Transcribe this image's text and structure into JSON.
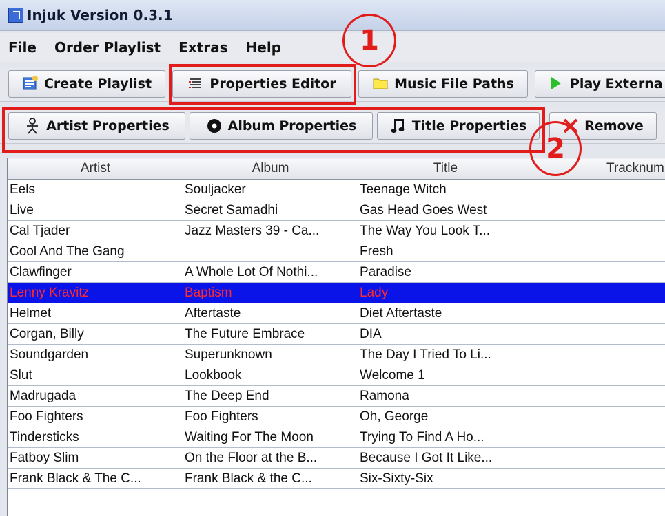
{
  "window": {
    "title": "Injuk Version 0.3.1"
  },
  "menu": [
    "File",
    "Order Playlist",
    "Extras",
    "Help"
  ],
  "toolbar1": [
    {
      "label": "Create Playlist",
      "icon": "playlist-icon"
    },
    {
      "label": "Properties Editor",
      "icon": "list-icon"
    },
    {
      "label": "Music File Paths",
      "icon": "folder-icon"
    },
    {
      "label": "Play Externa",
      "icon": "play-icon"
    }
  ],
  "toolbar2": [
    {
      "label": "Artist Properties",
      "icon": "person-icon"
    },
    {
      "label": "Album Properties",
      "icon": "disc-icon"
    },
    {
      "label": "Title Properties",
      "icon": "music-note-icon"
    },
    {
      "label": "Remove",
      "icon": "remove-icon"
    }
  ],
  "annotations": {
    "one": "1",
    "two": "2"
  },
  "table": {
    "columns": [
      "Artist",
      "Album",
      "Title",
      "Tracknumbe"
    ],
    "rows": [
      [
        "Eels",
        "Souljacker",
        "Teenage Witch",
        ""
      ],
      [
        "Live",
        "Secret Samadhi",
        "Gas Head Goes West",
        ""
      ],
      [
        "Cal Tjader",
        "Jazz Masters 39 - Ca...",
        "The Way You Look T...",
        ""
      ],
      [
        "Cool And The Gang",
        "",
        "Fresh",
        ""
      ],
      [
        "Clawfinger",
        "A Whole Lot Of Nothi...",
        "Paradise",
        ""
      ],
      [
        "Lenny Kravitz",
        "Baptism",
        "Lady",
        ""
      ],
      [
        "Helmet",
        "Aftertaste",
        "Diet Aftertaste",
        ""
      ],
      [
        "Corgan, Billy",
        "The Future Embrace",
        "DIA",
        ""
      ],
      [
        "Soundgarden",
        "Superunknown",
        "The Day I Tried To Li...",
        ""
      ],
      [
        "Slut",
        "Lookbook",
        "Welcome 1",
        ""
      ],
      [
        "Madrugada",
        "The Deep End",
        "Ramona",
        ""
      ],
      [
        "Foo Fighters",
        "Foo Fighters",
        "Oh, George",
        ""
      ],
      [
        "Tindersticks",
        "Waiting For The Moon",
        "Trying To Find A Ho...",
        ""
      ],
      [
        "Fatboy Slim",
        "On the Floor at the B...",
        "Because I Got It Like...",
        ""
      ],
      [
        "Frank Black & The C...",
        "Frank Black & the C...",
        "Six-Sixty-Six",
        ""
      ]
    ],
    "selected_row": 5
  },
  "colors": {
    "highlight": "#e21b1b",
    "selection_bg": "#0a14e8",
    "selection_text": "#ff2b2b"
  }
}
